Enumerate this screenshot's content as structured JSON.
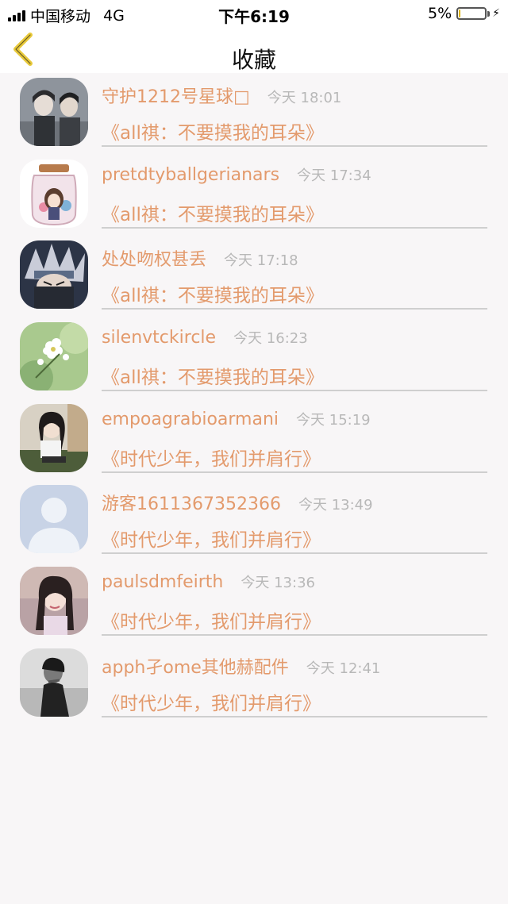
{
  "status_bar": {
    "carrier": "中国移动",
    "network": "4G",
    "time": "下午6:19",
    "battery_percent": "5%",
    "battery_level": 0.05,
    "icons": [
      "signal-bars-icon",
      "battery-icon",
      "charging-bolt-icon"
    ]
  },
  "nav": {
    "title": "收藏",
    "back_icon": "chevron-left-icon",
    "accent_color": "#e8c93a"
  },
  "colors": {
    "name": "#e39a6c",
    "time": "#b8b8b8",
    "divider": "#cfcfcf",
    "background": "#f8f6f7"
  },
  "favorites": [
    {
      "name": "守护1212号星球□",
      "time": "今天 18:01",
      "work": "《all祺：不要摸我的耳朵》"
    },
    {
      "name": "pretdtyballgerianars",
      "time": "今天 17:34",
      "work": "《all祺：不要摸我的耳朵》"
    },
    {
      "name": "处处吻权甚丢",
      "time": "今天 17:18",
      "work": "《all祺：不要摸我的耳朵》"
    },
    {
      "name": "silenvtckircle",
      "time": "今天 16:23",
      "work": "《all祺：不要摸我的耳朵》"
    },
    {
      "name": "empoagrabioarmani",
      "time": "今天 15:19",
      "work": "《时代少年，我们并肩行》"
    },
    {
      "name": "游客1611367352366",
      "time": "今天 13:49",
      "work": "《时代少年，我们并肩行》"
    },
    {
      "name": "paulsdmfeirth",
      "time": "今天 13:36",
      "work": "《时代少年，我们并肩行》"
    },
    {
      "name": "apph孑ome其他赫配件",
      "time": "今天 12:41",
      "work": "《时代少年，我们并肩行》"
    }
  ]
}
